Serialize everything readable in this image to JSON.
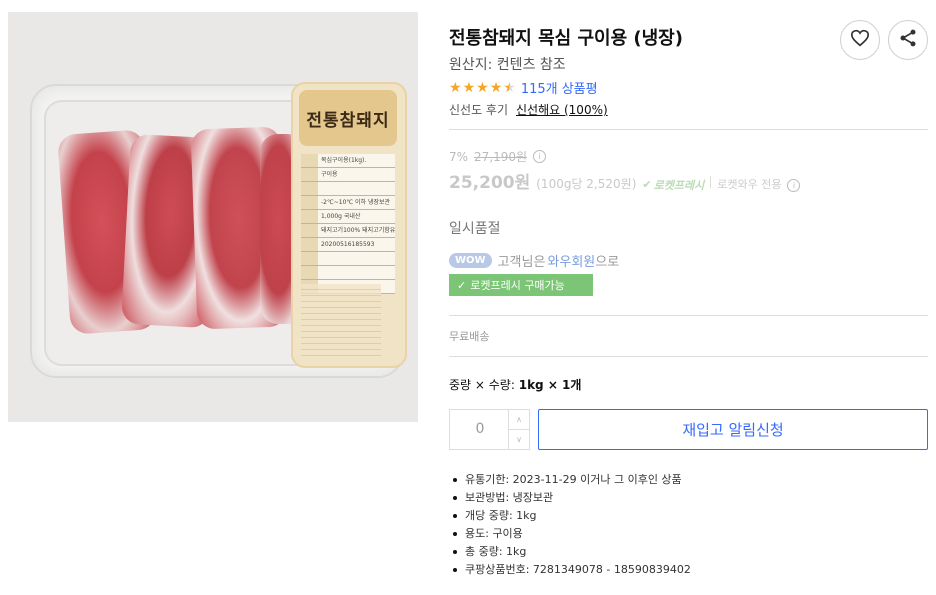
{
  "product": {
    "title": "전통참돼지 목심 구이용 (냉장)",
    "origin": "원산지: 컨텐츠 참조",
    "rating": 4.5,
    "review_count": "115개 상품평",
    "freshness_label": "신선도 후기",
    "freshness_value": "신선해요 (100%)"
  },
  "image": {
    "logo_text": "전통참돼지",
    "label_rows": [
      "목심구이용(1kg).",
      "구이용",
      "",
      "-2℃~10℃ 이하 냉장보관",
      "1,000g 국내산",
      "돼지고기100% 돼지고기함유",
      "20200516185593",
      "",
      "",
      ""
    ]
  },
  "pricing": {
    "discount": "7%",
    "original_price": "27,190원",
    "price": "25,200원",
    "unit_price": "(100g당 2,520원)",
    "rocket_fresh": "로켓프레시",
    "wow_only": "로켓와우 전용"
  },
  "status": {
    "soldout": "일시품절",
    "wow_badge": "WOW",
    "wow_text_prefix": "고객님은",
    "wow_member": "와우회원",
    "wow_text_suffix": "으로",
    "rocket_badge": "로켓프레시 구매가능"
  },
  "shipping": "무료배송",
  "option": {
    "label": "중량 × 수량:",
    "value": "1kg × 1개"
  },
  "purchase": {
    "quantity": "0",
    "notify_label": "재입고 알림신청"
  },
  "details": [
    "유통기한: 2023-11-29 이거나 그 이후인 상품",
    "보관방법: 냉장보관",
    "개당 중량: 1kg",
    "용도: 구이용",
    "총 중량: 1kg",
    "쿠팡상품번호: 7281349078 - 18590839402"
  ],
  "colors": {
    "accent": "#346aff",
    "rocket_green": "#7cc576",
    "star": "#f5a623"
  },
  "icons": {
    "wishlist": "heart-icon",
    "share": "share-icon",
    "check": "check-icon"
  }
}
